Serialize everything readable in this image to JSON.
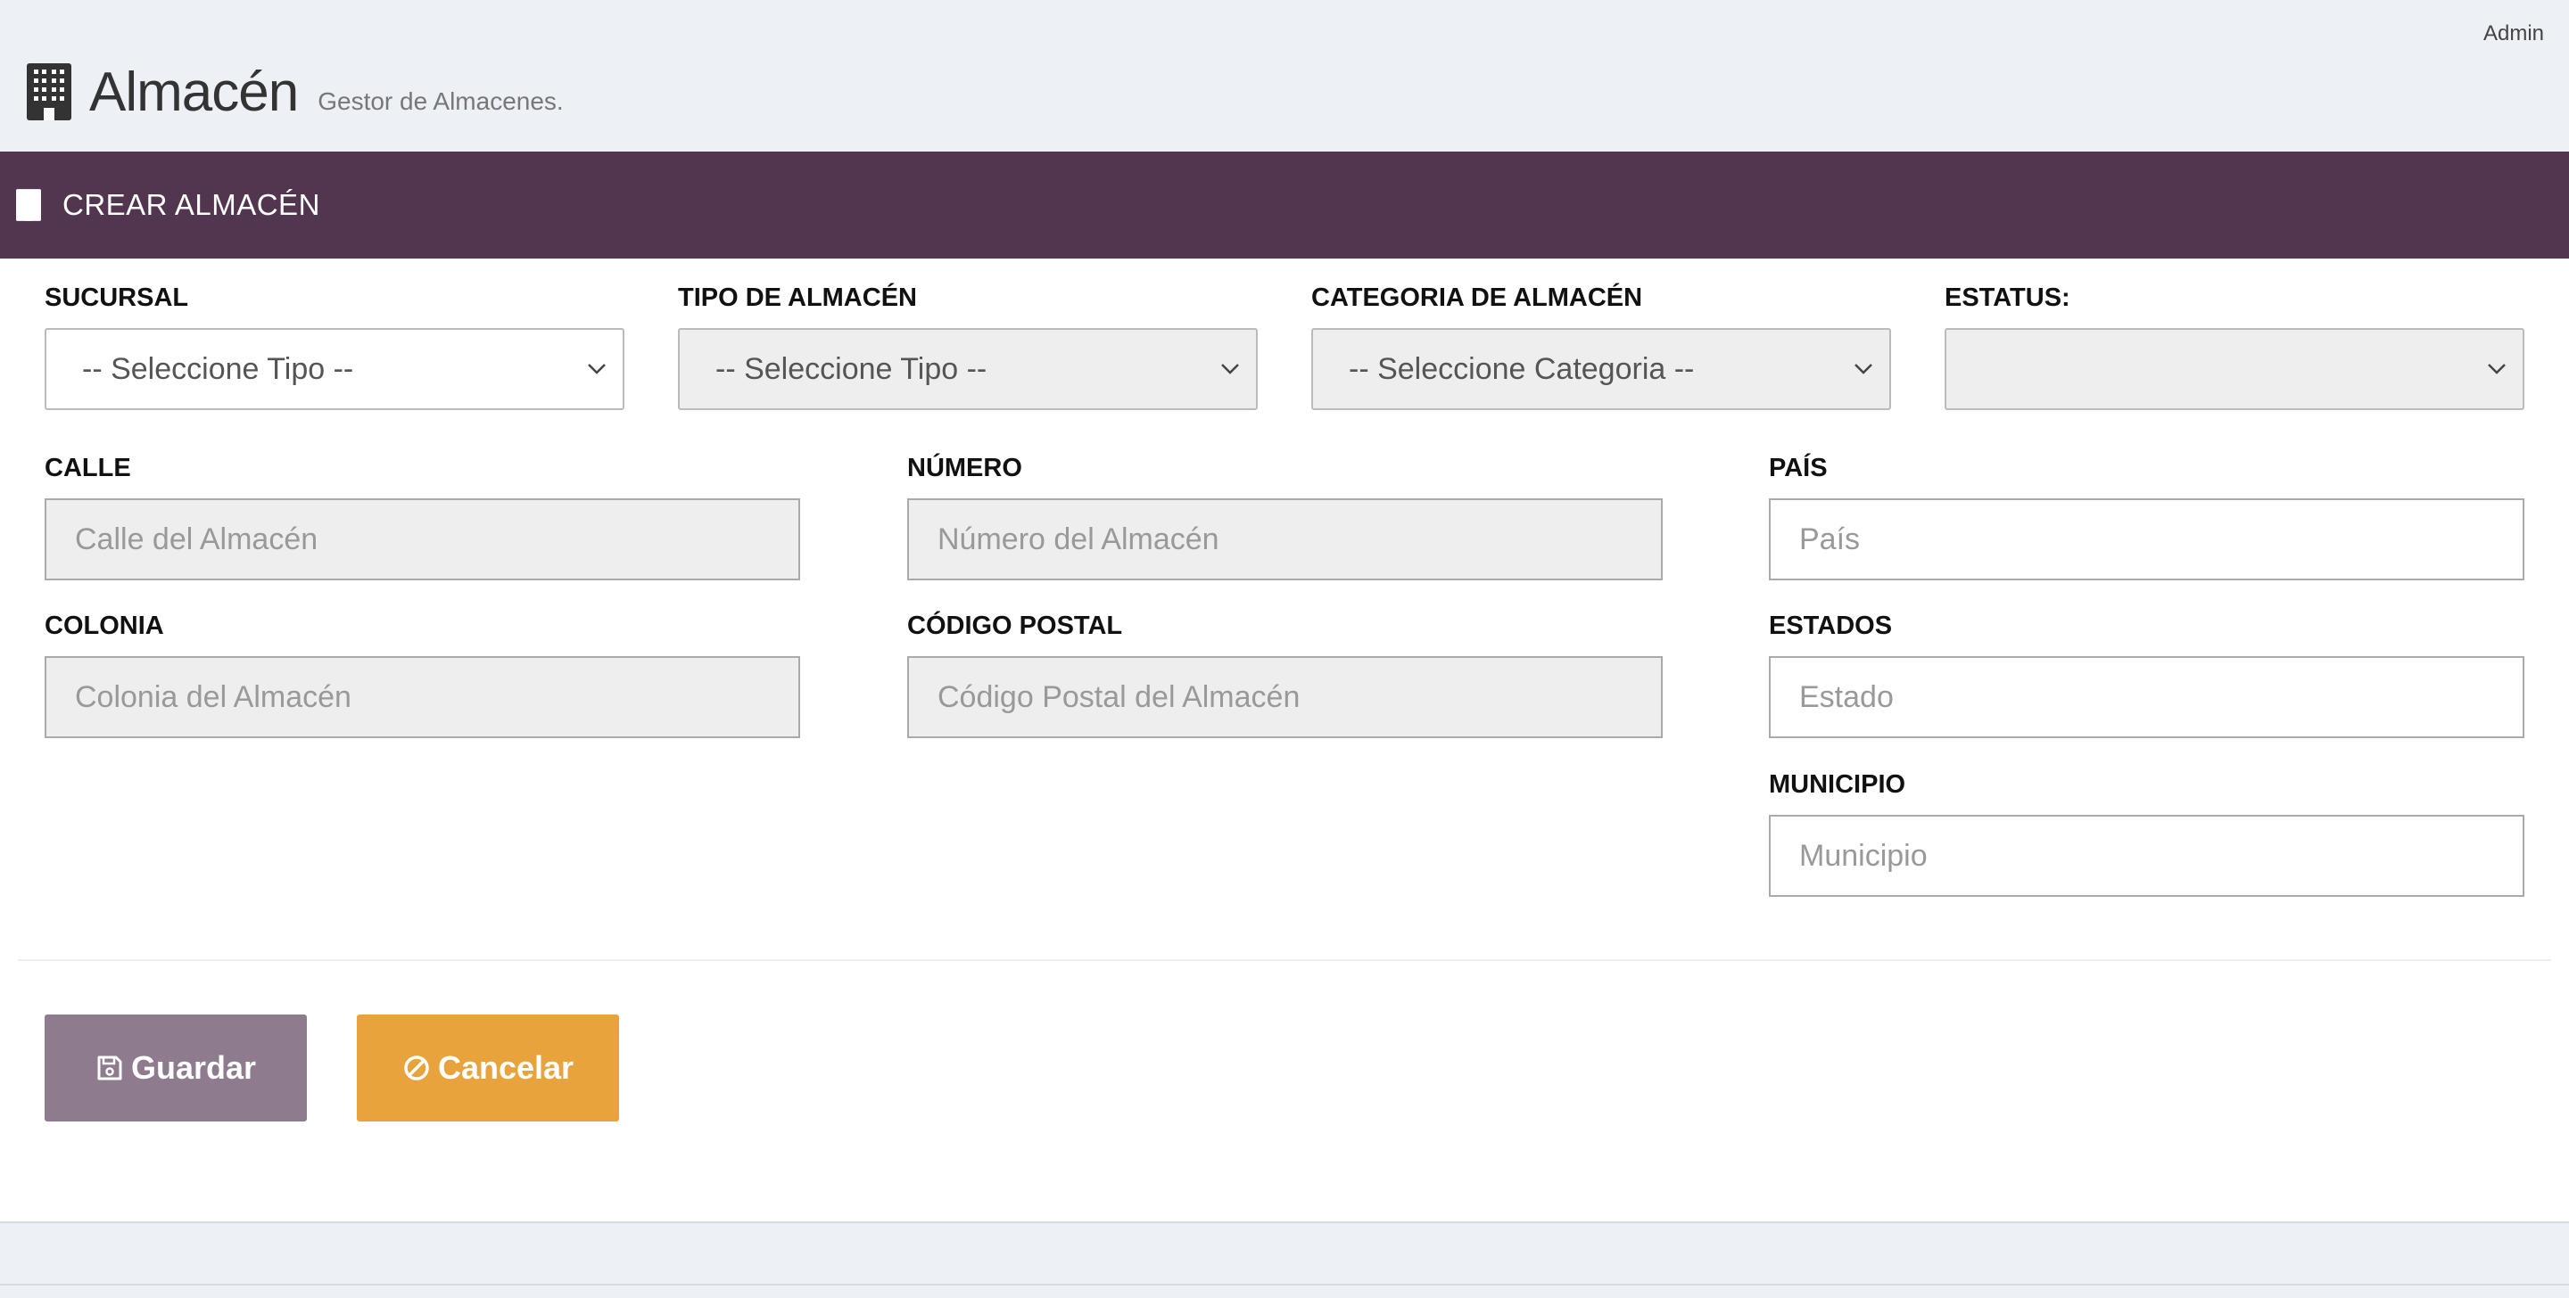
{
  "header": {
    "user": "Admin",
    "title": "Almacén",
    "subtitle": "Gestor de Almacenes.",
    "icon": "building-icon"
  },
  "panel": {
    "title": "CREAR ALMACÉN",
    "icon": "building-icon",
    "color": "#52364f"
  },
  "form": {
    "sucursal": {
      "label": "SUCURSAL",
      "value": "-- Seleccione Tipo --"
    },
    "tipo": {
      "label": "TIPO DE ALMACÉN",
      "value": "-- Seleccione Tipo --"
    },
    "categoria": {
      "label": "CATEGORIA DE ALMACÉN",
      "value": "-- Seleccione Categoria --"
    },
    "estatus": {
      "label": "ESTATUS:",
      "value": ""
    },
    "calle": {
      "label": "CALLE",
      "placeholder": "Calle del Almacén"
    },
    "numero": {
      "label": "NÚMERO",
      "placeholder": "Número del Almacén"
    },
    "pais": {
      "label": "PAÍS",
      "placeholder": "País"
    },
    "colonia": {
      "label": "COLONIA",
      "placeholder": "Colonia del Almacén"
    },
    "cp": {
      "label": "CÓDIGO POSTAL",
      "placeholder": "Código Postal del Almacén"
    },
    "estados": {
      "label": "ESTADOS",
      "placeholder": "Estado"
    },
    "municipio": {
      "label": "MUNICIPIO",
      "placeholder": "Municipio"
    }
  },
  "actions": {
    "save": {
      "label": "Guardar",
      "icon": "floppy-disk-icon",
      "color": "#8f7b8e"
    },
    "cancel": {
      "label": "Cancelar",
      "icon": "ban-icon",
      "color": "#e8a33d"
    }
  }
}
